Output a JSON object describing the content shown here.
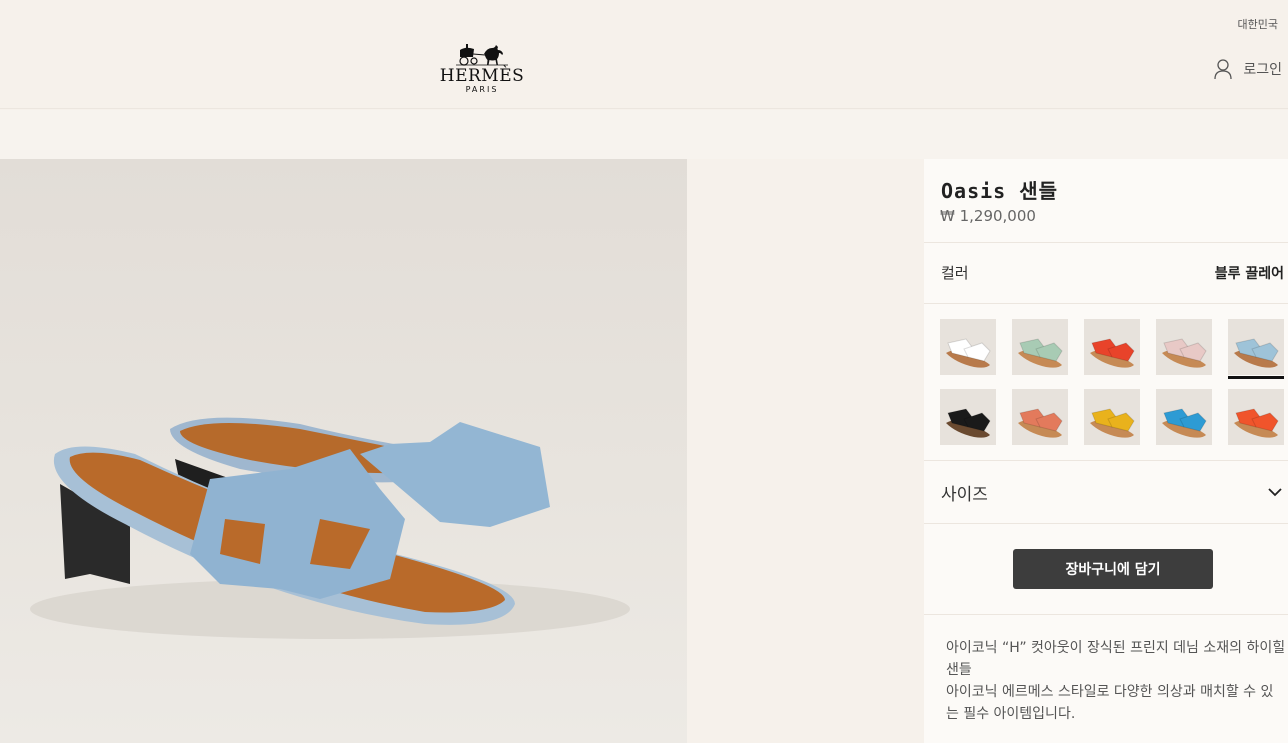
{
  "header": {
    "region": "대한민국",
    "logo": {
      "name": "HERMÈS",
      "city": "PARIS"
    },
    "login_label": "로그인"
  },
  "product": {
    "title": "Oasis 샌들",
    "price": "₩ 1,290,000",
    "color_label": "컬러",
    "color_value": "블루 끌레어",
    "swatches": [
      {
        "color": "#ffffff",
        "accent": "#b87a4b"
      },
      {
        "color": "#a8cbb4",
        "accent": "#c68a55"
      },
      {
        "color": "#e8432a",
        "accent": "#c68a55"
      },
      {
        "color": "#e8c9c6",
        "accent": "#c68a55"
      },
      {
        "color": "#9ec3d8",
        "accent": "#b87a4b",
        "selected": true
      },
      {
        "color": "#1a1a1a",
        "accent": "#6a4a30"
      },
      {
        "color": "#e37a5c",
        "accent": "#c68a55"
      },
      {
        "color": "#e9b21c",
        "accent": "#c68a55"
      },
      {
        "color": "#2d9bd4",
        "accent": "#c68a55"
      },
      {
        "color": "#f0542b",
        "accent": "#c68a55"
      }
    ],
    "size_label": "사이즈",
    "add_to_cart": "장바구니에 담기",
    "description_lines": [
      "아이코닉 “H” 컷아웃이 장식된 프린지 데님 소재의 하이힐 샌들",
      "아이코닉 에르메스 스타일로 다양한 의상과 매치할 수 있는 필수 아이템입니다."
    ]
  },
  "colors": {
    "button": "#3d3d3d",
    "background": "#f6f1eb",
    "panel": "#fcfaf7"
  }
}
